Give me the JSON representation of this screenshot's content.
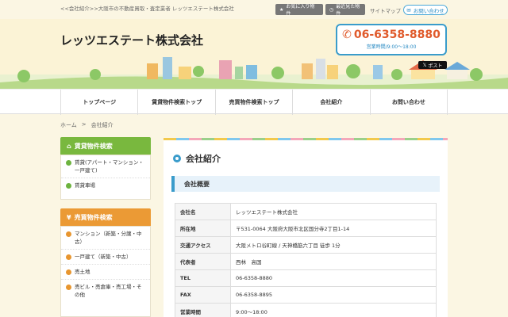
{
  "topbar": {
    "tagline": "<<会社紹介>>大阪市の不動産買取・査定業者 レッツエステート株式会社",
    "favorites_label": "お気に入り物件",
    "recent_label": "最近見た物件",
    "sitemap_label": "サイトマップ",
    "contact_label": "お問い合わせ"
  },
  "header": {
    "site_title": "レッツエステート株式会社",
    "phone": "06-6358-8880",
    "hours": "営業時間/9:00～18:00",
    "post_label": "ポスト"
  },
  "nav": [
    "トップページ",
    "賃貸物件検索トップ",
    "売買物件検索トップ",
    "会社紹介",
    "お問い合わせ"
  ],
  "breadcrumb": {
    "home": "ホーム",
    "sep": ">",
    "current": "会社紹介"
  },
  "sidebar": {
    "rental": {
      "title": "賃貸物件検索",
      "items": [
        "賃貸(アパート・マンション・一戸建て)",
        "賃貸車場"
      ]
    },
    "sale": {
      "title": "売買物件検索",
      "items": [
        "マンション（新築・分譲・中古）",
        "一戸建て（新築・中古）",
        "売土地",
        "売ビル・売倉庫・売工場・その他"
      ]
    }
  },
  "main": {
    "page_title": "会社紹介",
    "section_title": "会社概要",
    "rows": [
      {
        "key": "会社名",
        "value": "レッツエステート株式会社"
      },
      {
        "key": "所在地",
        "value": "〒531-0064 大阪府大阪市北区国分寺2丁目1-14"
      },
      {
        "key": "交通アクセス",
        "value": "大阪メトロ谷町線 / 天神橋筋六丁目 徒歩 1分"
      },
      {
        "key": "代表者",
        "value": "西林　高国"
      },
      {
        "key": "TEL",
        "value": "06-6358-8880"
      },
      {
        "key": "FAX",
        "value": "06-6358-8895"
      },
      {
        "key": "営業時間",
        "value": "9:00～18:00"
      }
    ]
  },
  "colors": {
    "accent_blue": "#3a9ccb",
    "green_head": "#79b83e",
    "orange_head": "#eb9a35",
    "phone_red": "#e05a2b"
  },
  "icons": [
    "star-icon",
    "clock-icon",
    "mail-icon",
    "phone-icon",
    "x-logo-icon",
    "house-icon",
    "yen-icon",
    "ring-icon"
  ]
}
